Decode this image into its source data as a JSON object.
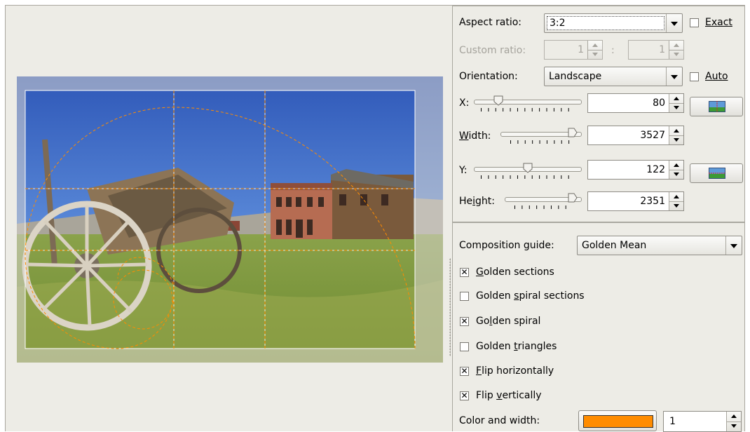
{
  "crop": {
    "aspect_ratio": {
      "label": "Aspect ratio:",
      "value": "3:2"
    },
    "exact": {
      "label": "Exact",
      "checked": false
    },
    "custom_ratio": {
      "label": "Custom ratio:",
      "left": "1",
      "separator": ":",
      "right": "1"
    },
    "orientation": {
      "label": "Orientation:",
      "value": "Landscape"
    },
    "auto": {
      "label": "Auto",
      "checked": false
    },
    "x": {
      "label": "X:",
      "value": "80"
    },
    "width": {
      "label": "Width:",
      "value": "3527"
    },
    "y": {
      "label": "Y:",
      "value": "122"
    },
    "height": {
      "label": "Height:",
      "value": "2351"
    }
  },
  "composition": {
    "guide": {
      "label": "Composition guide:",
      "value": "Golden Mean"
    },
    "options": [
      {
        "label": "Golden sections",
        "checked": true
      },
      {
        "label": "Golden spiral sections",
        "checked": false
      },
      {
        "label": "Golden spiral",
        "checked": true
      },
      {
        "label": "Golden triangles",
        "checked": false
      },
      {
        "label": "Flip horizontally",
        "checked": true
      },
      {
        "label": "Flip vertically",
        "checked": true
      }
    ],
    "color_width": {
      "label": "Color and width:",
      "color": "#ff8c00",
      "width": "1"
    }
  },
  "icons": {
    "center_horizontal": "center-horizontal-icon",
    "center_vertical": "center-vertical-icon"
  }
}
